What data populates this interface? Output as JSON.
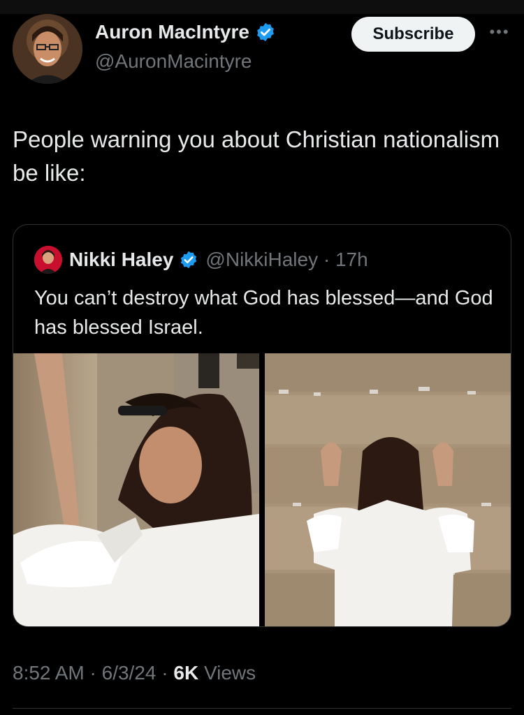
{
  "author": {
    "name": "Auron MacIntyre",
    "handle": "@AuronMacintyre",
    "verified_color": "#1d9bf0"
  },
  "actions": {
    "subscribe_label": "Subscribe",
    "more_label": "•••"
  },
  "tweet": {
    "text": "People warning you about Christian nationalism be like:"
  },
  "quoted": {
    "name": "Nikki Haley",
    "handle": "@NikkiHaley",
    "separator": "·",
    "time": "17h",
    "text": "You can’t destroy what God has blessed—and God has blessed Israel.",
    "images": [
      {
        "subject": "woman in white shirt praying with forehead against stone wall"
      },
      {
        "subject": "woman in white shirt with both hands on stone wall, back view"
      }
    ]
  },
  "meta": {
    "time": "8:52 AM",
    "sep1": " · ",
    "date": "6/3/24",
    "sep2": " · ",
    "views_count": "6K",
    "views_label": " Views"
  }
}
